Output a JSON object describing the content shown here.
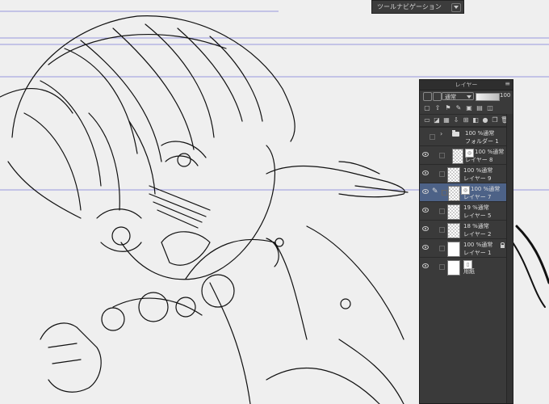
{
  "top_bar": {
    "title": "ツールナビゲーション"
  },
  "layer_panel": {
    "title": "レイヤー",
    "blend_mode": "通常",
    "opacity": "100",
    "layers": [
      {
        "line1": "100 %通常",
        "line2": "フォルダー 1",
        "type": "folder",
        "selected": false,
        "visible": false,
        "has_mask": false,
        "locked": false,
        "editing": false
      },
      {
        "line1": "100 %通常",
        "line2": "レイヤー 8",
        "type": "raster",
        "selected": false,
        "visible": true,
        "has_mask": true,
        "locked": false,
        "editing": false
      },
      {
        "line1": "100 %通常",
        "line2": "レイヤー 9",
        "type": "raster",
        "selected": false,
        "visible": true,
        "has_mask": false,
        "locked": false,
        "editing": false
      },
      {
        "line1": "100 %通常",
        "line2": "レイヤー 7",
        "type": "raster",
        "selected": true,
        "visible": true,
        "has_mask": true,
        "locked": false,
        "editing": true
      },
      {
        "line1": "19 %通常",
        "line2": "レイヤー 5",
        "type": "raster",
        "selected": false,
        "visible": true,
        "has_mask": false,
        "locked": false,
        "editing": false
      },
      {
        "line1": "18 %通常",
        "line2": "レイヤー 2",
        "type": "raster",
        "selected": false,
        "visible": true,
        "has_mask": false,
        "locked": false,
        "editing": false
      },
      {
        "line1": "100 %通常",
        "line2": "レイヤー 1",
        "type": "raster",
        "selected": false,
        "visible": true,
        "has_mask": false,
        "locked": true,
        "editing": false
      },
      {
        "line1": "",
        "line2": "用紙",
        "type": "paper",
        "selected": false,
        "visible": true,
        "has_mask": true,
        "locked": false,
        "editing": false
      }
    ]
  },
  "colors": {
    "panel_bg": "#3a3a3a",
    "selected_row": "#4d6287",
    "guide_line": "#6a6ad0"
  }
}
